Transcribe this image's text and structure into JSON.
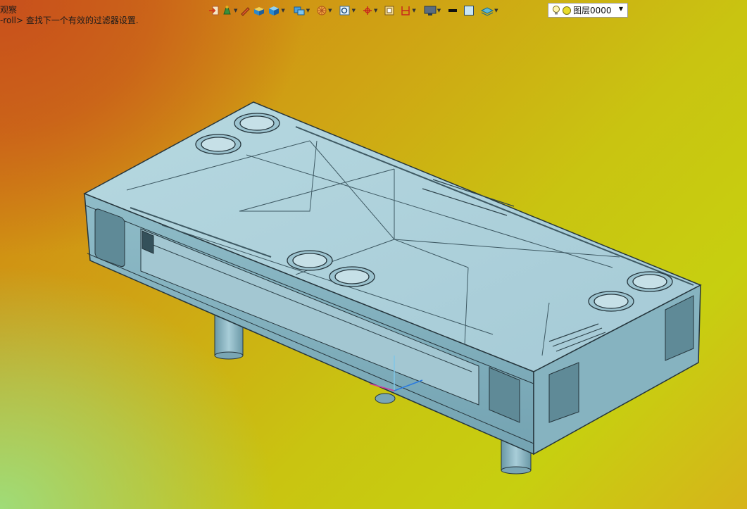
{
  "viewport": {
    "hint_line1": "观察",
    "hint_line2": "-roll> 查找下一个有效的过滤器设置."
  },
  "toolbar": {
    "icons": [
      "import-icon",
      "paint-icon",
      "pencil-icon",
      "solid-box-icon",
      "cube-view-icon",
      "display-mode-icon",
      "render-wheel-icon",
      "zoom-fit-icon",
      "snap-point-icon",
      "frame-icon",
      "section-icon",
      "monitor-icon",
      "line-color-swatch",
      "fill-color-swatch",
      "layer-stack-icon"
    ],
    "layer": {
      "bulb": "bulb-icon",
      "value": "图层0000"
    }
  },
  "colors": {
    "model_fill": "#8fbcc8",
    "model_dark": "#6f9fae",
    "model_light": "#b5d9e2",
    "edge": "#26363d"
  }
}
